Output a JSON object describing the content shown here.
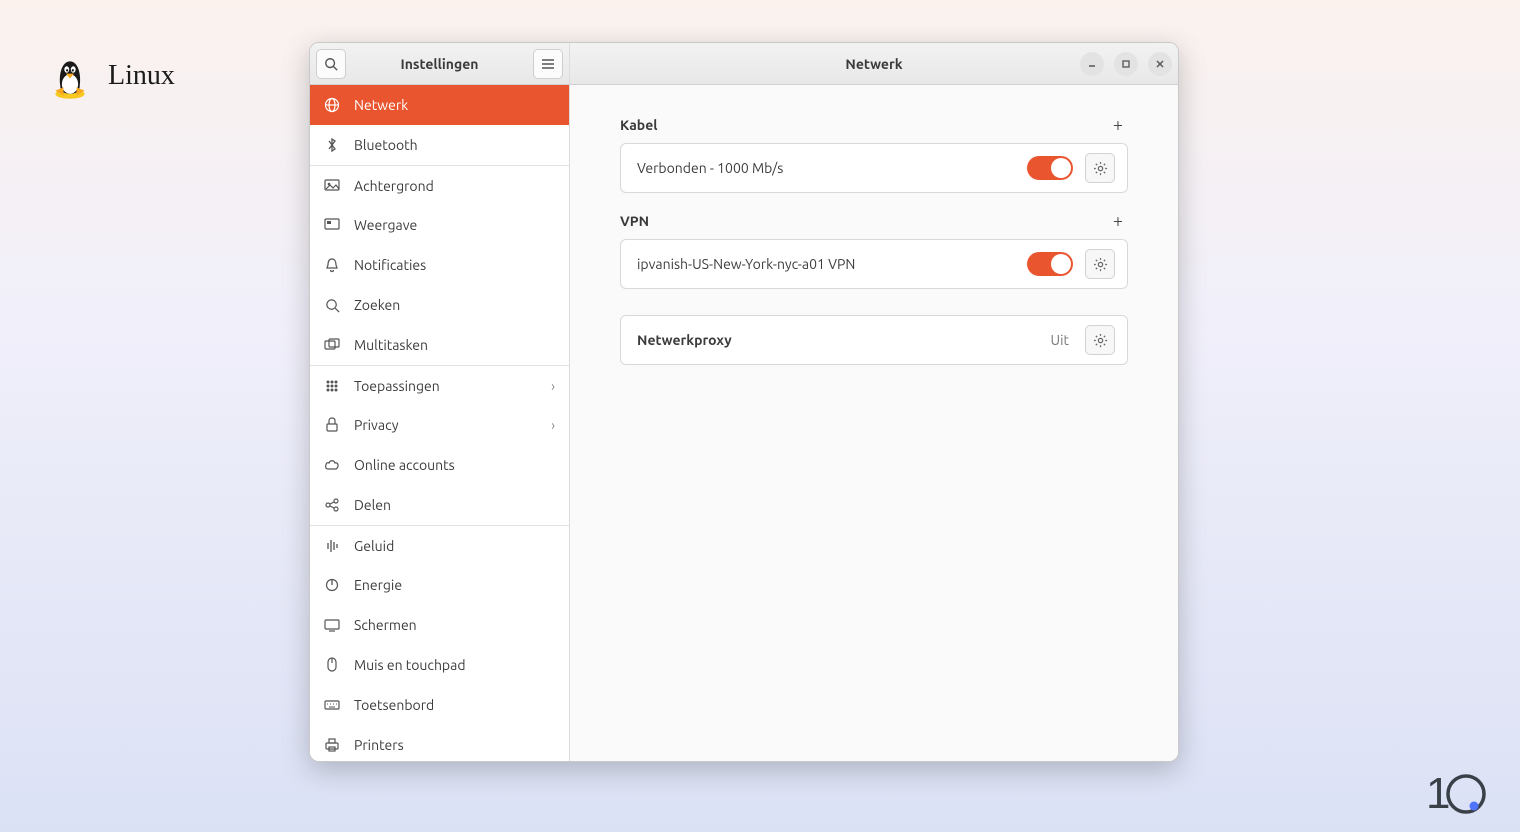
{
  "badge": {
    "label": "Linux"
  },
  "sidebar": {
    "title": "Instellingen",
    "items": [
      {
        "label": "Netwerk"
      },
      {
        "label": "Bluetooth"
      },
      {
        "label": "Achtergrond"
      },
      {
        "label": "Weergave"
      },
      {
        "label": "Notificaties"
      },
      {
        "label": "Zoeken"
      },
      {
        "label": "Multitasken"
      },
      {
        "label": "Toepassingen"
      },
      {
        "label": "Privacy"
      },
      {
        "label": "Online accounts"
      },
      {
        "label": "Delen"
      },
      {
        "label": "Geluid"
      },
      {
        "label": "Energie"
      },
      {
        "label": "Schermen"
      },
      {
        "label": "Muis en touchpad"
      },
      {
        "label": "Toetsenbord"
      },
      {
        "label": "Printers"
      }
    ]
  },
  "main": {
    "title": "Netwerk",
    "kabel": {
      "heading": "Kabel",
      "status": "Verbonden - 1000 Mb/s"
    },
    "vpn": {
      "heading": "VPN",
      "name": "ipvanish-US-New-York-nyc-a01 VPN"
    },
    "proxy": {
      "label": "Netwerkproxy",
      "status": "Uit"
    }
  },
  "watermark": "10"
}
